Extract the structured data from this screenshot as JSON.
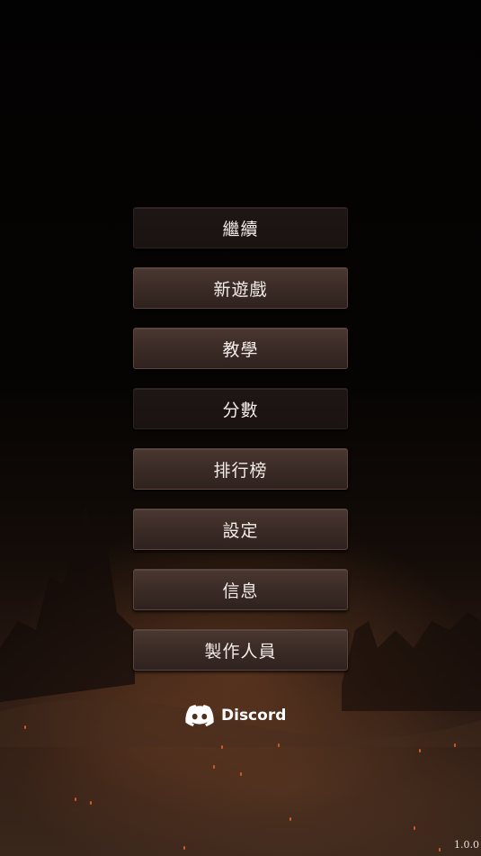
{
  "menu": {
    "items": [
      {
        "label": "繼續",
        "enabled": false
      },
      {
        "label": "新遊戲",
        "enabled": true
      },
      {
        "label": "教學",
        "enabled": true
      },
      {
        "label": "分數",
        "enabled": false
      },
      {
        "label": "排行榜",
        "enabled": true
      },
      {
        "label": "設定",
        "enabled": true
      },
      {
        "label": "信息",
        "enabled": true
      },
      {
        "label": "製作人員",
        "enabled": true
      }
    ]
  },
  "discord": {
    "label": "Discord",
    "icon": "discord-icon"
  },
  "version": "1.0.0",
  "colors": {
    "button_face": "#3b2b26",
    "button_disabled": "#1c1412",
    "text": "#f2ece8",
    "ember": "#e0602a"
  }
}
